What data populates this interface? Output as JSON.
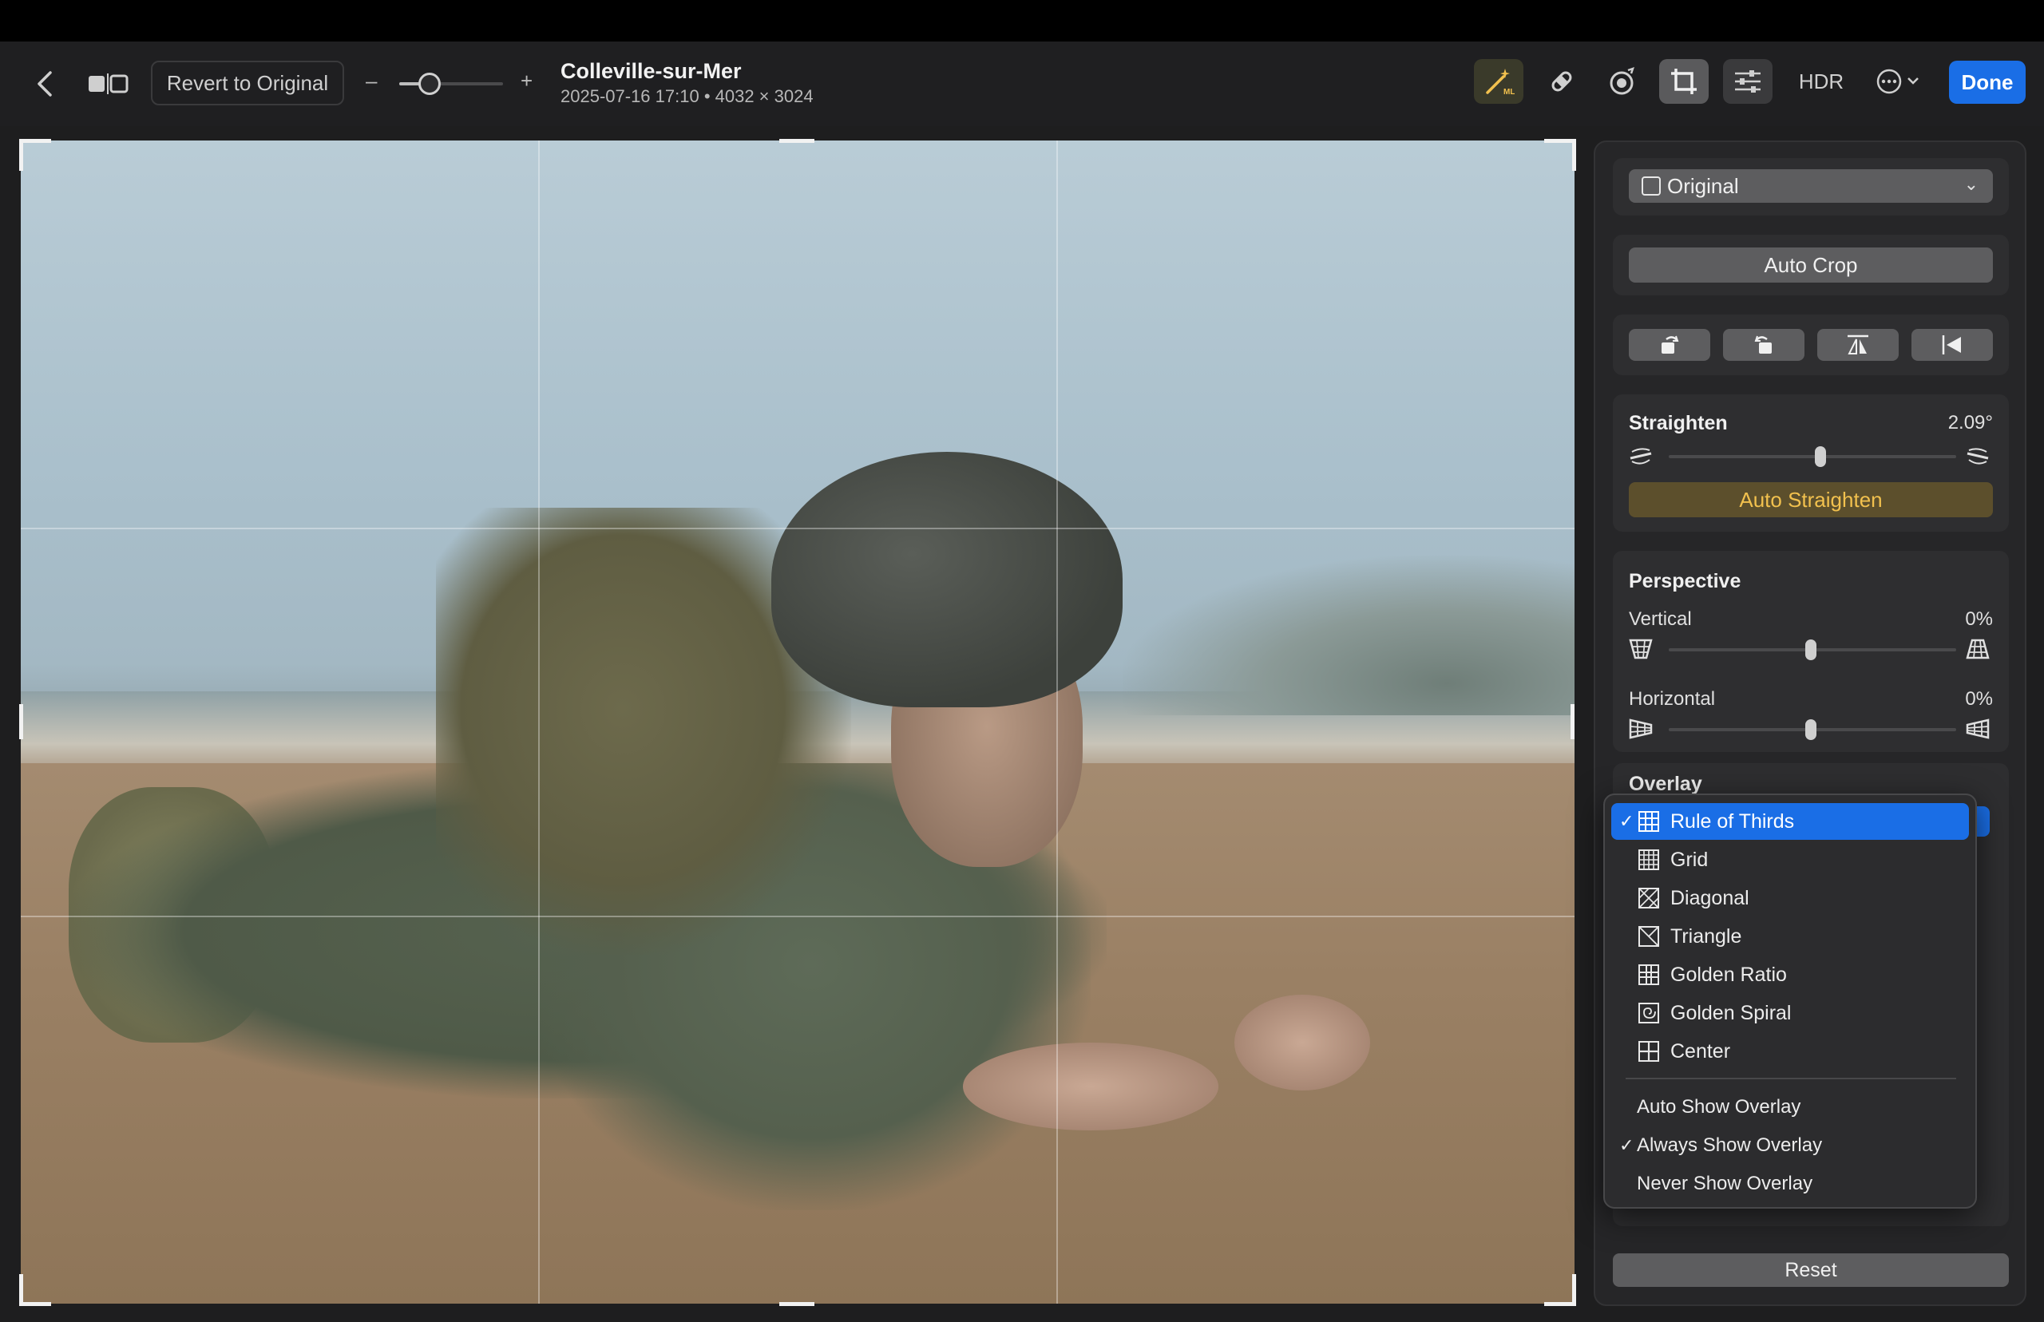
{
  "toolbar": {
    "revert_label": "Revert to Original",
    "zoom_minus": "–",
    "zoom_plus": "+",
    "title": "Colleville-sur-Mer",
    "subtitle": "2025-07-16 17:10 • 4032 × 3024",
    "hdr_label": "HDR",
    "done_label": "Done",
    "icons": [
      "back-chevron-icon",
      "compare-icon",
      "enhance-wand-icon",
      "retouch-bandage-icon",
      "redeye-icon",
      "crop-icon",
      "adjust-sliders-icon",
      "more-ellipsis-icon"
    ]
  },
  "panel": {
    "aspect": {
      "value": "Original"
    },
    "auto_crop_label": "Auto Crop",
    "tools": [
      "rotate-left-icon",
      "rotate-right-icon",
      "flip-vertical-icon",
      "flip-horizontal-icon"
    ],
    "straighten": {
      "label": "Straighten",
      "value": "2.09°",
      "level": 0.58,
      "auto_label": "Auto Straighten"
    },
    "perspective": {
      "label": "Perspective",
      "vertical_label": "Vertical",
      "vertical_value": "0%",
      "horizontal_label": "Horizontal",
      "horizontal_value": "0%"
    },
    "overlay_label": "Overlay",
    "reset_label": "Reset"
  },
  "overlay_menu": {
    "items": [
      {
        "label": "Rule of Thirds",
        "checked": true,
        "icon": "rule-of-thirds-icon"
      },
      {
        "label": "Grid",
        "checked": false,
        "icon": "grid-icon"
      },
      {
        "label": "Diagonal",
        "checked": false,
        "icon": "diagonal-icon"
      },
      {
        "label": "Triangle",
        "checked": false,
        "icon": "triangle-icon"
      },
      {
        "label": "Golden Ratio",
        "checked": false,
        "icon": "golden-ratio-icon"
      },
      {
        "label": "Golden Spiral",
        "checked": false,
        "icon": "golden-spiral-icon"
      },
      {
        "label": "Center",
        "checked": false,
        "icon": "center-icon"
      }
    ],
    "show_options": [
      {
        "label": "Auto Show Overlay",
        "checked": false
      },
      {
        "label": "Always Show Overlay",
        "checked": true
      },
      {
        "label": "Never Show Overlay",
        "checked": false
      }
    ],
    "check_glyph": "✓"
  },
  "colors": {
    "accent": "#1a6ee6",
    "auto_straighten_text": "#f2c14e",
    "auto_straighten_bg": "#5c4f2c",
    "panel_bg": "#262628"
  }
}
